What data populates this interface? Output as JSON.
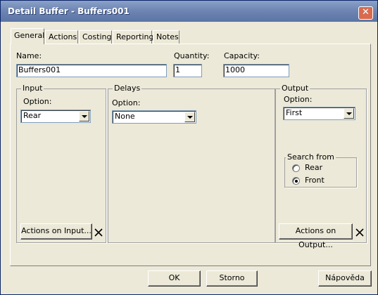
{
  "window": {
    "title": "Detail Buffer - Buffers001",
    "close_glyph": "✕"
  },
  "tabs": [
    {
      "label": "General",
      "active": true
    },
    {
      "label": "Actions",
      "active": false
    },
    {
      "label": "Costing",
      "active": false
    },
    {
      "label": "Reporting",
      "active": false
    },
    {
      "label": "Notes",
      "active": false
    }
  ],
  "general": {
    "name_label": "Name:",
    "name_value": "Buffers001",
    "quantity_label": "Quantity:",
    "quantity_value": "1",
    "capacity_label": "Capacity:",
    "capacity_value": "1000"
  },
  "input_group": {
    "title": "Input",
    "option_label": "Option:",
    "option_value": "Rear",
    "actions_button": "Actions on Input...",
    "delete_icon": "close-x-icon"
  },
  "delays_group": {
    "title": "Delays",
    "option_label": "Option:",
    "option_value": "None"
  },
  "output_group": {
    "title": "Output",
    "option_label": "Option:",
    "option_value": "First",
    "search_from": {
      "title": "Search from",
      "options": [
        {
          "label": "Rear",
          "checked": false
        },
        {
          "label": "Front",
          "checked": true
        }
      ]
    },
    "actions_button": "Actions on Output...",
    "delete_icon": "close-x-icon"
  },
  "footer": {
    "ok_label": "OK",
    "cancel_label": "Storno",
    "help_label": "Nápověda"
  }
}
